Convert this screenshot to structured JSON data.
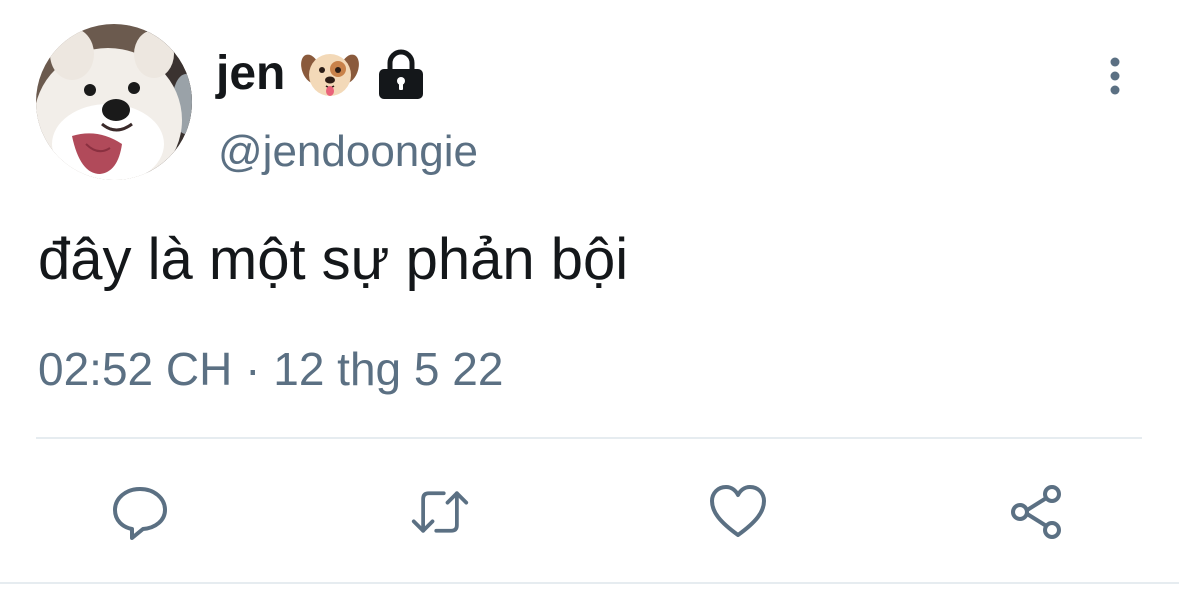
{
  "author": {
    "display_name": "jen",
    "handle": "@jendoongie",
    "name_emoji": "dog-face-emoji",
    "protected_icon": "lock-icon",
    "avatar": "samoyed-dog-avatar"
  },
  "tweet": {
    "text": "đây là một sự phản bội",
    "time": "02:52 CH",
    "separator": "·",
    "date": "12 thg 5 22"
  },
  "actions": [
    {
      "name": "reply",
      "icon": "comment-icon"
    },
    {
      "name": "retweet",
      "icon": "retweet-icon"
    },
    {
      "name": "like",
      "icon": "heart-icon"
    },
    {
      "name": "share",
      "icon": "share-icon"
    }
  ],
  "colors": {
    "text_primary": "#14171a",
    "text_secondary": "#5b7083",
    "icon": "#5b7083",
    "divider": "#e6ecf0",
    "background": "#ffffff"
  }
}
